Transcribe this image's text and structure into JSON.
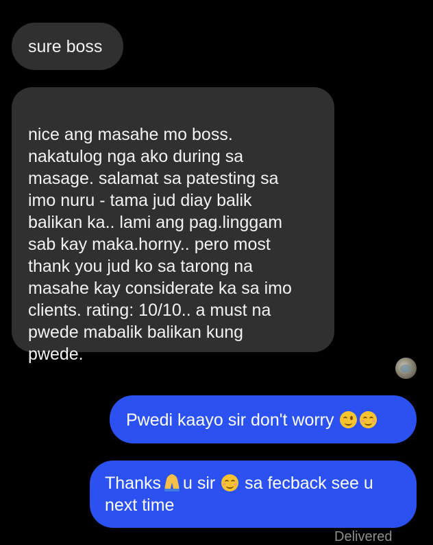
{
  "messages": [
    {
      "direction": "incoming",
      "text": "sure boss"
    },
    {
      "direction": "incoming",
      "text": "nice ang masahe mo boss.\nnakatulog nga ako during sa\nmasage. salamat sa patesting sa\nimo nuru - tama jud diay balik\nbalikan ka.. lami ang pag.linggam\nsab kay maka.horny.. pero most\nthank you jud ko sa tarong na\nmasahe kay considerate ka sa imo\nclients. rating: 10/10.. a must na\npwede mabalik balikan kung\npwede."
    },
    {
      "direction": "outgoing",
      "text": "Pwedi kaayo sir don't worry",
      "emojis": [
        "winking-face",
        "smiling-face-with-smiling-eyes"
      ]
    },
    {
      "direction": "outgoing",
      "parts": [
        "Thanks",
        "u sir",
        "sa fecback see u next time"
      ],
      "emojis": [
        "folded-hands",
        "smiling-face-with-smiling-eyes"
      ]
    }
  ],
  "avatar_icon": "contact-avatar",
  "status_text": "Delivered",
  "colors": {
    "background": "#000000",
    "incoming_bubble": "#303030",
    "outgoing_bubble": "#2b52f0"
  }
}
